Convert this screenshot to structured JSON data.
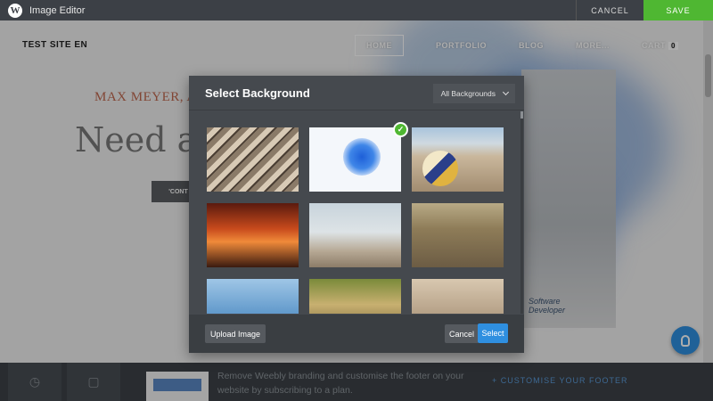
{
  "app": {
    "title": "Image Editor",
    "logo_letter": "W",
    "cancel_label": "CANCEL",
    "save_label": "SAVE",
    "save_color": "#4fb732"
  },
  "site": {
    "title": "TEST SITE EN",
    "nav": [
      "HOME",
      "PORTFOLIO",
      "BLOG",
      "MORE...",
      "CART"
    ],
    "cart_count": "0",
    "hero_subtitle": "MAX MEYER, A",
    "hero_title": "Need a",
    "hero_button": "'CONT",
    "shirt_text_1": "Software",
    "shirt_text_2": "Developer"
  },
  "modal": {
    "title": "Select Background",
    "filter_value": "All Backgrounds",
    "upload_label": "Upload Image",
    "cancel_label": "Cancel",
    "select_label": "Select",
    "accent": "#2f8fe0",
    "selected_index": 1,
    "thumbnails": [
      "architecture-pattern",
      "blue-ink-splash",
      "volleyball-beach",
      "sunset-cyclist",
      "beach-swing",
      "road-cyclist",
      "surfer",
      "mountain-bike-trees",
      "mountain-bike-trail"
    ]
  },
  "footer": {
    "promo_line_1": "Remove Weebly branding and customise the footer on your",
    "promo_line_2": "website by subscribing to a plan.",
    "link_label": "CUSTOMISE YOUR FOOTER"
  }
}
